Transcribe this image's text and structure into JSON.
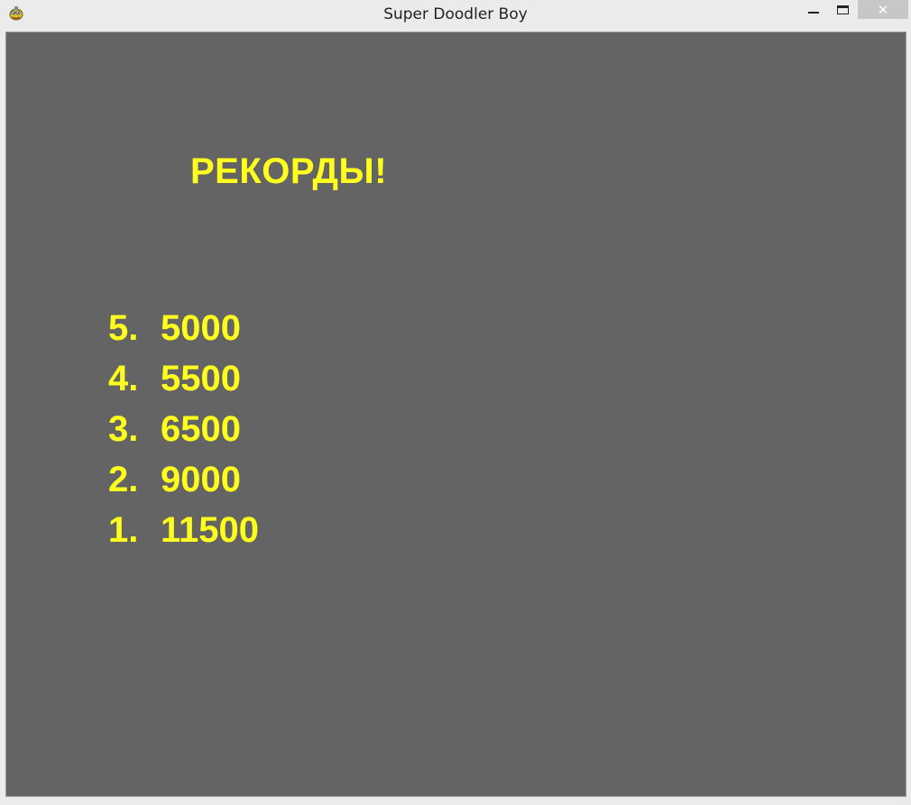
{
  "window": {
    "title": "Super Doodler Boy",
    "app_icon": "pygame-snake-icon",
    "controls": {
      "minimize_icon": "minimize-icon",
      "maximize_icon": "maximize-icon",
      "close_label": "✕"
    }
  },
  "game": {
    "background_color": "#646464",
    "text_color": "#ffff1e",
    "heading": "РЕКОРДЫ!",
    "scores": [
      {
        "rank": "5.",
        "value": "5000"
      },
      {
        "rank": "4.",
        "value": "5500"
      },
      {
        "rank": "3.",
        "value": "6500"
      },
      {
        "rank": "2.",
        "value": "9000"
      },
      {
        "rank": "1.",
        "value": "11500"
      }
    ]
  }
}
